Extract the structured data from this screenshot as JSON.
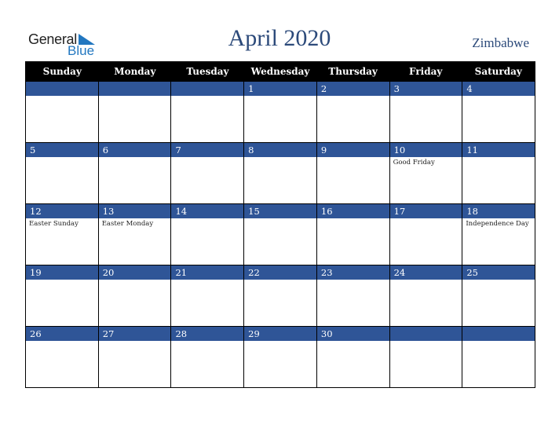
{
  "logo": {
    "line1": "General",
    "line2": "Blue"
  },
  "header": {
    "title": "April 2020",
    "country": "Zimbabwe"
  },
  "weekdays": [
    "Sunday",
    "Monday",
    "Tuesday",
    "Wednesday",
    "Thursday",
    "Friday",
    "Saturday"
  ],
  "weeks": [
    [
      {
        "day": "",
        "event": ""
      },
      {
        "day": "",
        "event": ""
      },
      {
        "day": "",
        "event": ""
      },
      {
        "day": "1",
        "event": ""
      },
      {
        "day": "2",
        "event": ""
      },
      {
        "day": "3",
        "event": ""
      },
      {
        "day": "4",
        "event": ""
      }
    ],
    [
      {
        "day": "5",
        "event": ""
      },
      {
        "day": "6",
        "event": ""
      },
      {
        "day": "7",
        "event": ""
      },
      {
        "day": "8",
        "event": ""
      },
      {
        "day": "9",
        "event": ""
      },
      {
        "day": "10",
        "event": "Good Friday"
      },
      {
        "day": "11",
        "event": ""
      }
    ],
    [
      {
        "day": "12",
        "event": "Easter Sunday"
      },
      {
        "day": "13",
        "event": "Easter Monday"
      },
      {
        "day": "14",
        "event": ""
      },
      {
        "day": "15",
        "event": ""
      },
      {
        "day": "16",
        "event": ""
      },
      {
        "day": "17",
        "event": ""
      },
      {
        "day": "18",
        "event": "Independence Day"
      }
    ],
    [
      {
        "day": "19",
        "event": ""
      },
      {
        "day": "20",
        "event": ""
      },
      {
        "day": "21",
        "event": ""
      },
      {
        "day": "22",
        "event": ""
      },
      {
        "day": "23",
        "event": ""
      },
      {
        "day": "24",
        "event": ""
      },
      {
        "day": "25",
        "event": ""
      }
    ],
    [
      {
        "day": "26",
        "event": ""
      },
      {
        "day": "27",
        "event": ""
      },
      {
        "day": "28",
        "event": ""
      },
      {
        "day": "29",
        "event": ""
      },
      {
        "day": "30",
        "event": ""
      },
      {
        "day": "",
        "event": ""
      },
      {
        "day": "",
        "event": ""
      }
    ]
  ],
  "colors": {
    "band": "#2f5597",
    "header_bg": "#000000",
    "title": "#2c4a7a",
    "logo_blue": "#2277c0"
  }
}
